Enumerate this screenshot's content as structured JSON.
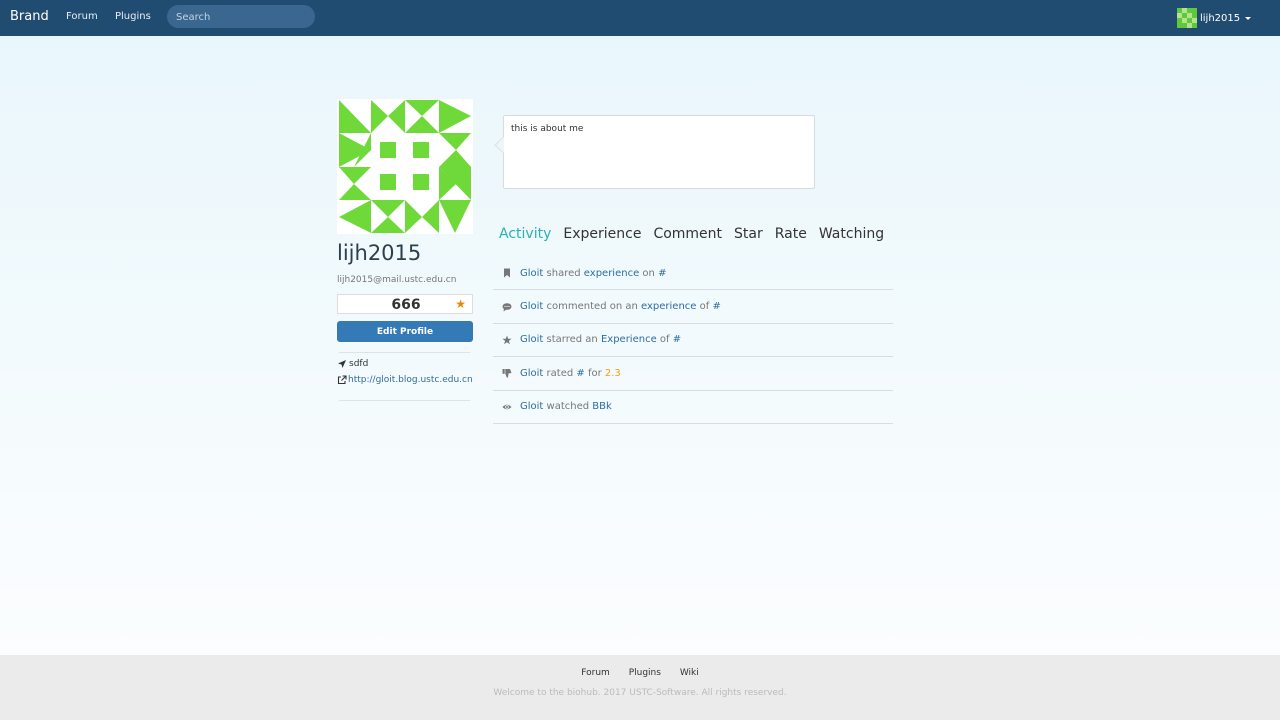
{
  "navbar": {
    "brand": "Brand",
    "links": [
      "Forum",
      "Plugins"
    ],
    "search_placeholder": "Search",
    "user_name": "lijh2015"
  },
  "profile": {
    "username": "lijh2015",
    "email": "lijh2015@mail.ustc.edu.cn",
    "score": "666",
    "edit_button": "Edit Profile",
    "location": "sdfd",
    "website": "http://gloit.blog.ustc.edu.cn",
    "about": "this is about me",
    "avatar_color": "#6fd93a"
  },
  "tabs": [
    "Activity",
    "Experience",
    "Comment",
    "Star",
    "Rate",
    "Watching"
  ],
  "activity": [
    {
      "icon": "bookmark-icon",
      "user": "Gloit",
      "parts": [
        " shared ",
        "experience",
        " on ",
        "#"
      ]
    },
    {
      "icon": "comment-icon",
      "user": "Gloit",
      "parts": [
        " commented on an ",
        "experience",
        " of ",
        "#"
      ]
    },
    {
      "icon": "star-icon",
      "user": "Gloit",
      "parts": [
        " starred an ",
        "Experience",
        " of ",
        "#"
      ]
    },
    {
      "icon": "thumbs-down-icon",
      "user": "Gloit",
      "parts": [
        " rated ",
        "#",
        " for ",
        "2.3"
      ]
    },
    {
      "icon": "eye-icon",
      "user": "Gloit",
      "parts": [
        " watched ",
        "BBk"
      ]
    }
  ],
  "footer": {
    "links": [
      "Forum",
      "Plugins",
      "Wiki"
    ],
    "copyright": "Welcome to the biohub. 2017 USTC-Software. All rights reserved."
  }
}
